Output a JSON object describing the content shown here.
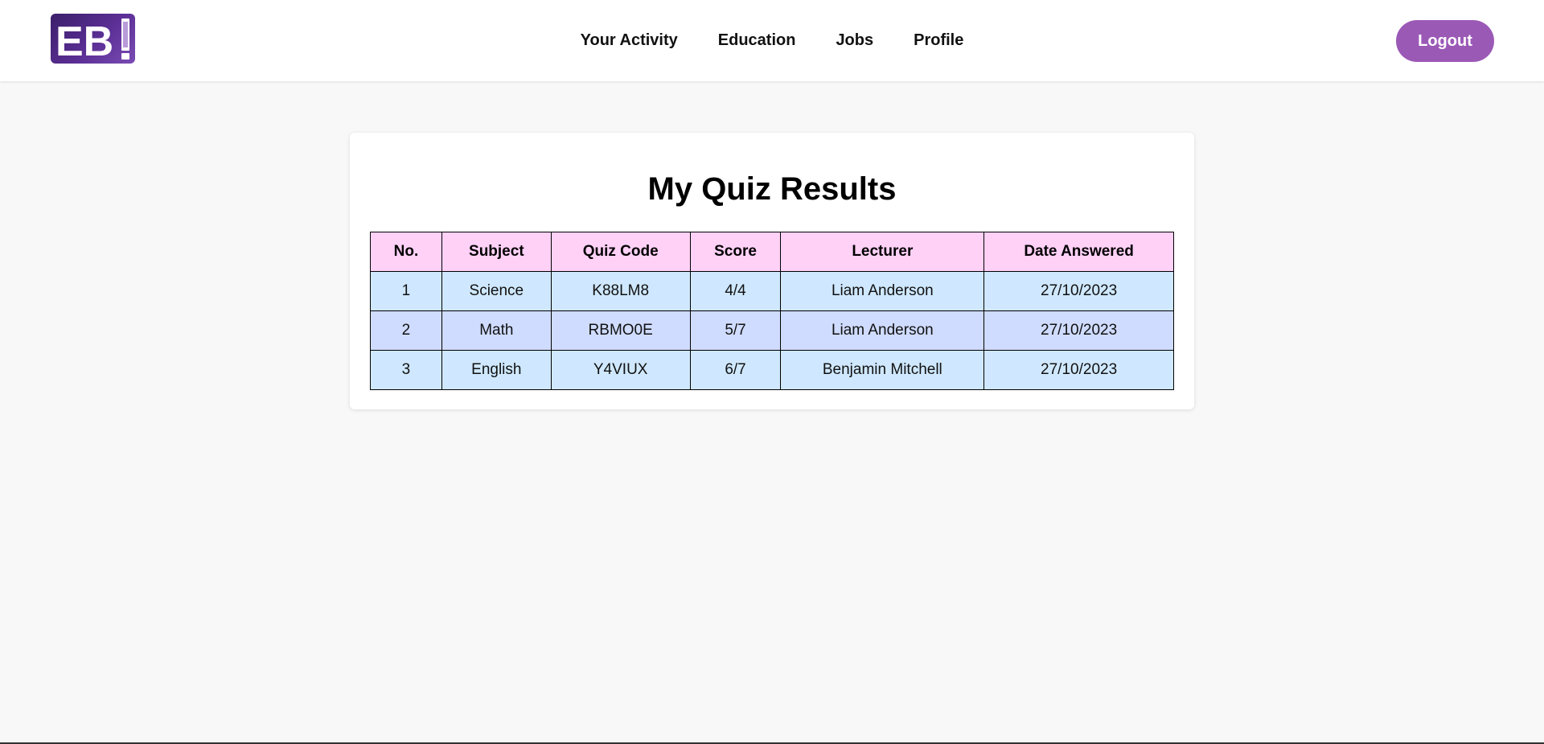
{
  "header": {
    "logo_text": "EB!",
    "nav": [
      {
        "label": "Your Activity"
      },
      {
        "label": "Education"
      },
      {
        "label": "Jobs"
      },
      {
        "label": "Profile"
      }
    ],
    "logout_label": "Logout"
  },
  "main": {
    "title": "My Quiz Results",
    "table": {
      "columns": [
        "No.",
        "Subject",
        "Quiz Code",
        "Score",
        "Lecturer",
        "Date Answered"
      ],
      "rows": [
        [
          "1",
          "Science",
          "K88LM8",
          "4/4",
          "Liam Anderson",
          "27/10/2023"
        ],
        [
          "2",
          "Math",
          "RBMO0E",
          "5/7",
          "Liam Anderson",
          "27/10/2023"
        ],
        [
          "3",
          "English",
          "Y4VIUX",
          "6/7",
          "Benjamin Mitchell",
          "27/10/2023"
        ]
      ]
    }
  },
  "colors": {
    "accent": "#9b59b6",
    "header_row": "#ffd1f7",
    "row_light": "#cfe8ff",
    "row_alt": "#cfdcff",
    "logo_bg": "#4a2780"
  }
}
